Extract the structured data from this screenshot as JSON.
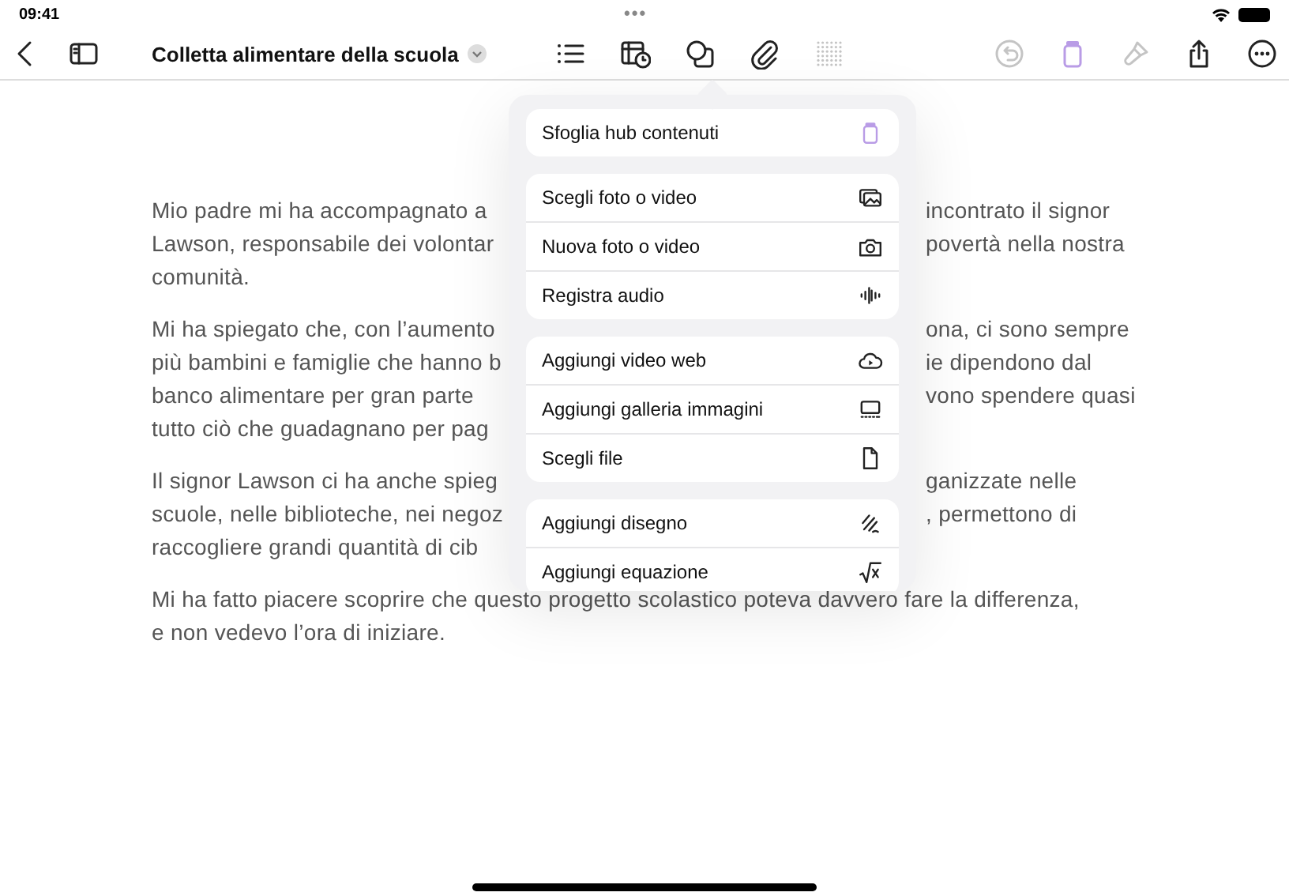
{
  "status_bar": {
    "time": "09:41",
    "handle": "•••"
  },
  "toolbar": {
    "title": "Colletta alimentare della scuola",
    "buttons": [
      {
        "kind": "back",
        "disabled": false,
        "accent": false
      },
      {
        "kind": "sidebar",
        "disabled": false,
        "accent": false
      },
      {
        "kind": "list",
        "disabled": false,
        "accent": false
      },
      {
        "kind": "table",
        "disabled": false,
        "accent": false
      },
      {
        "kind": "shapes",
        "disabled": false,
        "accent": false
      },
      {
        "kind": "attach",
        "disabled": false,
        "accent": false
      },
      {
        "kind": "grid",
        "disabled": true,
        "accent": false
      },
      {
        "kind": "undo",
        "disabled": true,
        "accent": false
      },
      {
        "kind": "hub",
        "disabled": false,
        "accent": true
      },
      {
        "kind": "brush",
        "disabled": true,
        "accent": false
      },
      {
        "kind": "share",
        "disabled": false,
        "accent": false
      },
      {
        "kind": "more",
        "disabled": false,
        "accent": false
      }
    ]
  },
  "document": {
    "paragraphs": [
      {
        "lines": [
          {
            "left": "Mio padre mi ha accompagnato a",
            "right": "incontrato il signor"
          },
          {
            "left": "Lawson, responsabile dei volontar",
            "right": "povertà nella nostra"
          },
          {
            "left": "comunità."
          }
        ]
      },
      {
        "lines": [
          {
            "left": "Mi ha spiegato che, con l’aumento",
            "right": "ona, ci sono sempre"
          },
          {
            "left": "più bambini e famiglie che hanno b",
            "right": "ie dipendono dal"
          },
          {
            "left": "banco alimentare per gran parte",
            "right": "vono spendere quasi"
          },
          {
            "left": "tutto ciò che guadagnano per pag"
          }
        ]
      },
      {
        "lines": [
          {
            "left": "Il signor Lawson ci ha anche spieg",
            "right": "ganizzate nelle"
          },
          {
            "left": "scuole, nelle biblioteche, nei negoz",
            "right": ", permettono di"
          },
          {
            "left": "raccogliere grandi quantità di cib"
          }
        ]
      },
      {
        "lines": [
          {
            "left": "Mi ha fatto piacere scoprire che questo progetto scolastico poteva davvero fare la differenza,"
          },
          {
            "left": "e non vedevo l’ora di iniziare."
          }
        ]
      }
    ]
  },
  "attach_menu": {
    "groups": [
      [
        {
          "label": "Sfoglia hub contenuti",
          "kind": "hub"
        }
      ],
      [
        {
          "label": "Scegli foto o video",
          "kind": "photos"
        },
        {
          "label": "Nuova foto o video",
          "kind": "camera"
        },
        {
          "label": "Registra audio",
          "kind": "waveform"
        }
      ],
      [
        {
          "label": "Aggiungi video web",
          "kind": "cloud"
        },
        {
          "label": "Aggiungi galleria immagini",
          "kind": "gallery"
        },
        {
          "label": "Scegli file",
          "kind": "file"
        }
      ],
      [
        {
          "label": "Aggiungi disegno",
          "kind": "scribble"
        },
        {
          "label": "Aggiungi equazione",
          "kind": "sqrt"
        }
      ]
    ]
  }
}
